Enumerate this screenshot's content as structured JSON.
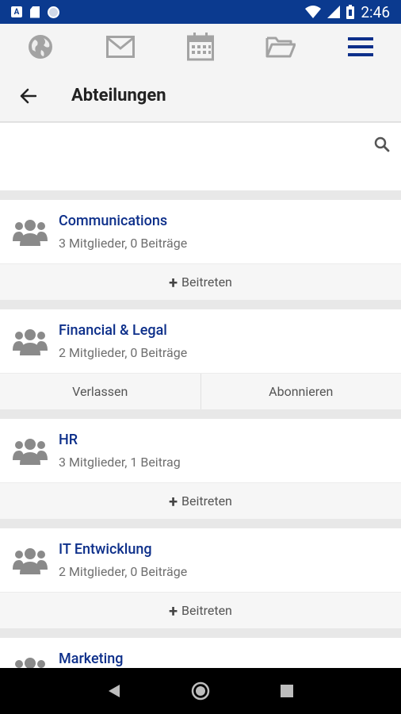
{
  "status_bar": {
    "time": "2:46"
  },
  "page": {
    "title": "Abteilungen"
  },
  "search": {
    "placeholder": ""
  },
  "departments": [
    {
      "name": "Communications",
      "meta": "3 Mitglieder, 0 Beiträge",
      "actions": [
        "Beitreten"
      ]
    },
    {
      "name": "Financial & Legal",
      "meta": "2 Mitglieder, 0 Beiträge",
      "actions": [
        "Verlassen",
        "Abonnieren"
      ]
    },
    {
      "name": "HR",
      "meta": "3 Mitglieder, 1 Beitrag",
      "actions": [
        "Beitreten"
      ]
    },
    {
      "name": "IT Entwicklung",
      "meta": "2 Mitglieder, 0 Beiträge",
      "actions": [
        "Beitreten"
      ]
    },
    {
      "name": "Marketing",
      "meta": "",
      "actions": []
    }
  ],
  "colors": {
    "status_bar": "#0b3a8f",
    "accent": "#0d2f8a"
  },
  "icons": {
    "nav": [
      "globe-icon",
      "mail-icon",
      "calendar-icon",
      "folder-icon",
      "menu-icon"
    ]
  }
}
